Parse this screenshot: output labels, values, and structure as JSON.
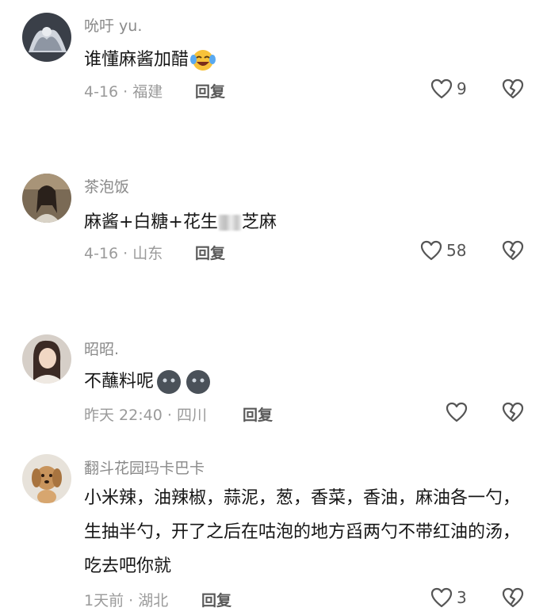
{
  "comments": [
    {
      "username": "吮吁 yu.",
      "text": "谁懂麻酱加醋",
      "emoji": "laughing-crying-emoji",
      "date": "4-16",
      "location": "福建",
      "reply_label": "回复",
      "likes": "9"
    },
    {
      "username": "茶泡饭",
      "text_before": "麻酱+白糖+花生",
      "text_after": "芝麻",
      "date": "4-16",
      "location": "山东",
      "reply_label": "回复",
      "likes": "58"
    },
    {
      "username": "昭昭.",
      "text": "不蘸料呢",
      "emoji": "dark-moon-face-emoji",
      "date": "昨天 22:40",
      "location": "四川",
      "reply_label": "回复",
      "likes": ""
    },
    {
      "username": "翻斗花园玛卡巴卡",
      "text": "小米辣，油辣椒，蒜泥，葱，香菜，香油，麻油各一勺，生抽半勺，开了之后在咕泡的地方舀两勺不带红油的汤，吃去吧你就",
      "date": "1天前",
      "location": "湖北",
      "reply_label": "回复",
      "likes": "3"
    }
  ],
  "meta_separator": "·",
  "icons": {
    "like": "heart-outline-icon",
    "dislike": "broken-heart-icon"
  }
}
